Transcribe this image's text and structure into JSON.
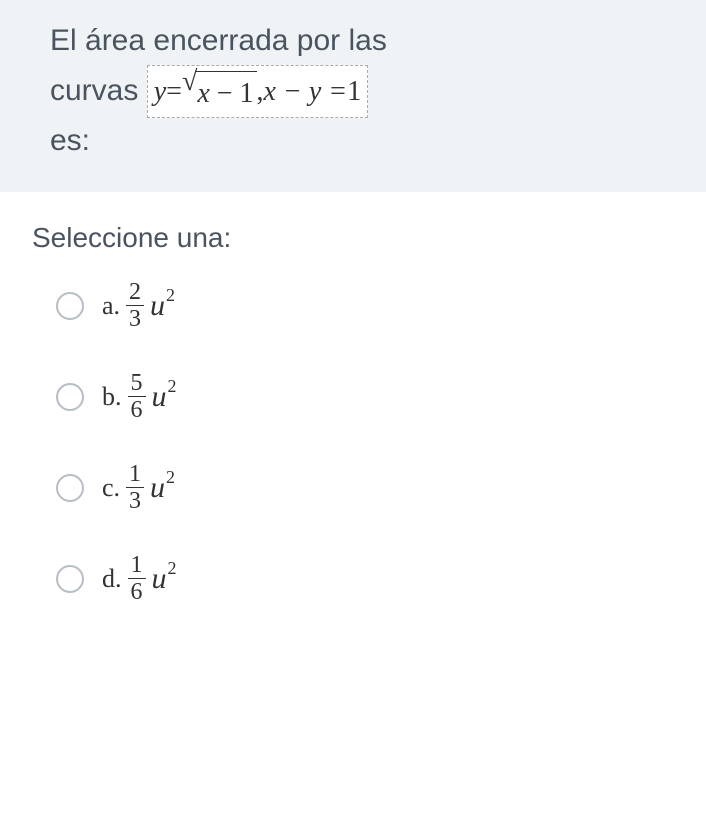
{
  "question": {
    "line1": "El área encerrada por las",
    "line2_prefix": "curvas",
    "equation": {
      "y": "y",
      "eq1": " = ",
      "sqrt_sym": "√",
      "sqrt_arg_x": "x",
      "sqrt_arg_rest": " − 1",
      "comma": ", ",
      "part2": "x − y = ",
      "one": "1"
    },
    "line3": "es:"
  },
  "prompt": "Seleccione una:",
  "options": [
    {
      "letter": "a.",
      "num": "2",
      "den": "3",
      "base": "u",
      "exp": "2"
    },
    {
      "letter": "b.",
      "num": "5",
      "den": "6",
      "base": "u",
      "exp": "2"
    },
    {
      "letter": "c.",
      "num": "1",
      "den": "3",
      "base": "u",
      "exp": "2"
    },
    {
      "letter": "d.",
      "num": "1",
      "den": "6",
      "base": "u",
      "exp": "2"
    }
  ]
}
